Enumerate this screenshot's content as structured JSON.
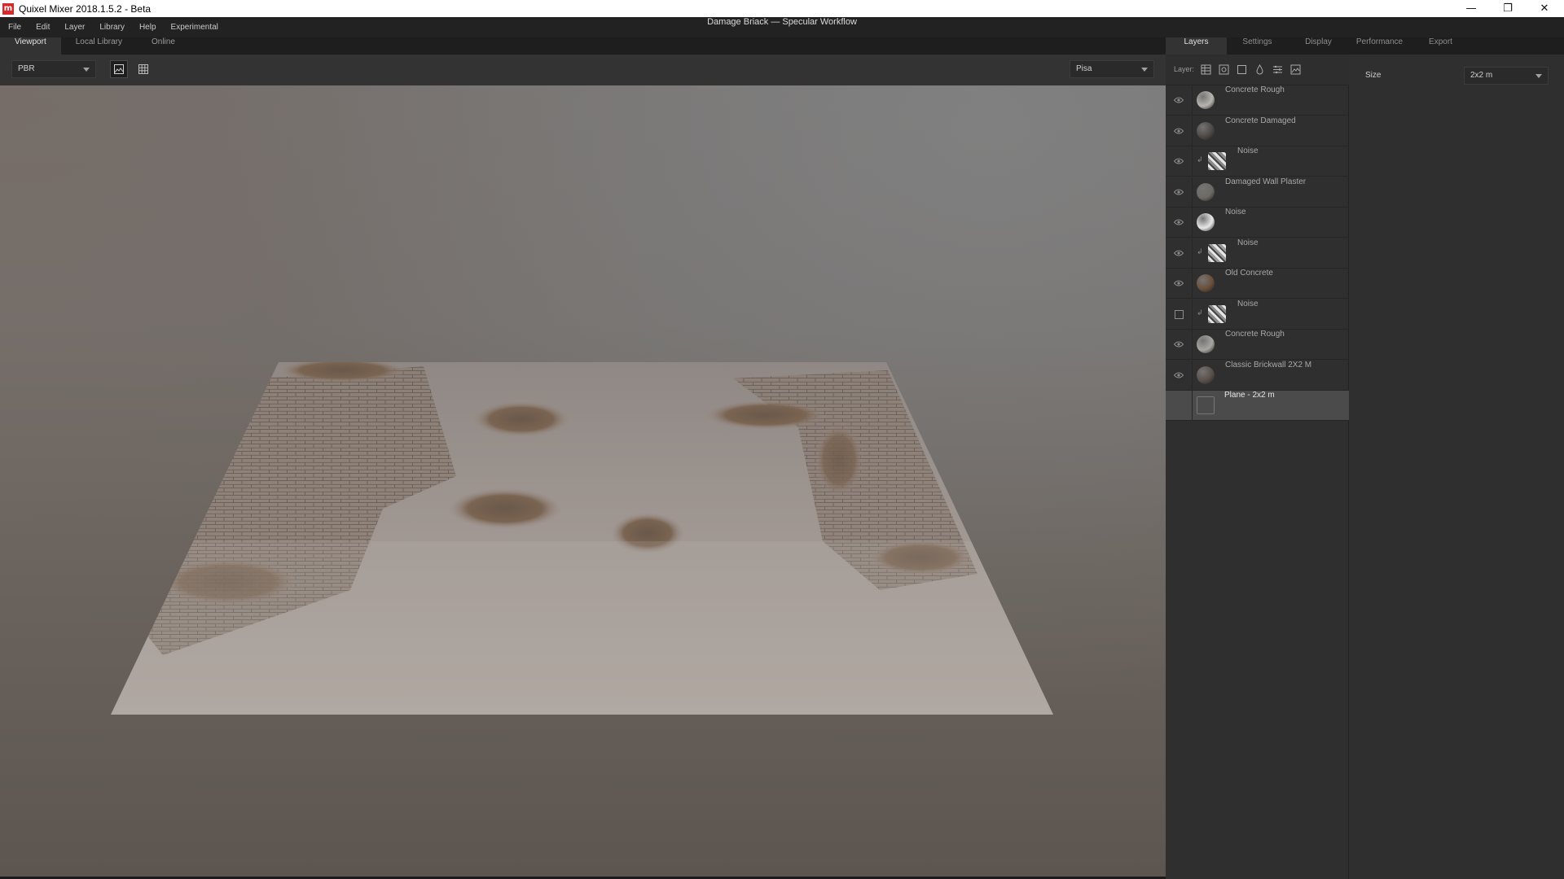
{
  "window": {
    "app_title": "Quixel Mixer 2018.1.5.2 - Beta",
    "logo_letter": "m",
    "document_title": "Damage Briack — Specular Workflow",
    "controls": {
      "minimize": "—",
      "maximize": "❐",
      "close": "✕"
    }
  },
  "menu": [
    "File",
    "Edit",
    "Layer",
    "Library",
    "Help",
    "Experimental"
  ],
  "viewport_tabs": [
    "Viewport",
    "Local Library",
    "Online"
  ],
  "viewport_toolbar": {
    "render_mode": "PBR",
    "environment": "Pisa"
  },
  "right_tabs": [
    "Layers",
    "Settings",
    "Display",
    "Performance",
    "Export"
  ],
  "layer_toolbar": {
    "label": "Layer:"
  },
  "layers": [
    {
      "name": "Concrete Rough",
      "visible": true,
      "masked": false,
      "thumb": "#b8b4ae"
    },
    {
      "name": "Concrete Damaged",
      "visible": true,
      "masked": false,
      "thumb": "#4d4844"
    },
    {
      "name": "Noise",
      "visible": true,
      "masked": true,
      "thumb": "#8a8a8a"
    },
    {
      "name": "Damaged Wall Plaster",
      "visible": true,
      "masked": false,
      "thumb": "#6e6964"
    },
    {
      "name": "Noise",
      "visible": true,
      "masked": false,
      "thumb": "#e8e8e8"
    },
    {
      "name": "Noise",
      "visible": true,
      "masked": true,
      "thumb": "#9a9a9a"
    },
    {
      "name": "Old Concrete",
      "visible": true,
      "masked": false,
      "thumb": "#6a4f3a"
    },
    {
      "name": "Noise",
      "visible": false,
      "masked": true,
      "thumb": "#8c8c8c"
    },
    {
      "name": "Concrete Rough",
      "visible": true,
      "masked": false,
      "thumb": "#a9a5a0"
    },
    {
      "name": "Classic Brickwall 2X2 M",
      "visible": true,
      "masked": false,
      "thumb": "#5a4f48"
    },
    {
      "name": "Plane - 2x2 m",
      "visible": null,
      "masked": false,
      "thumb": "#3a3a3a",
      "selected": true
    }
  ],
  "properties": {
    "size_label": "Size",
    "size_value": "2x2 m"
  },
  "colors": {
    "panel": "#2f2f2f",
    "tab_bar": "#1e1e1e",
    "selected_row": "#4b4b4b",
    "logo": "#d42a2a"
  }
}
